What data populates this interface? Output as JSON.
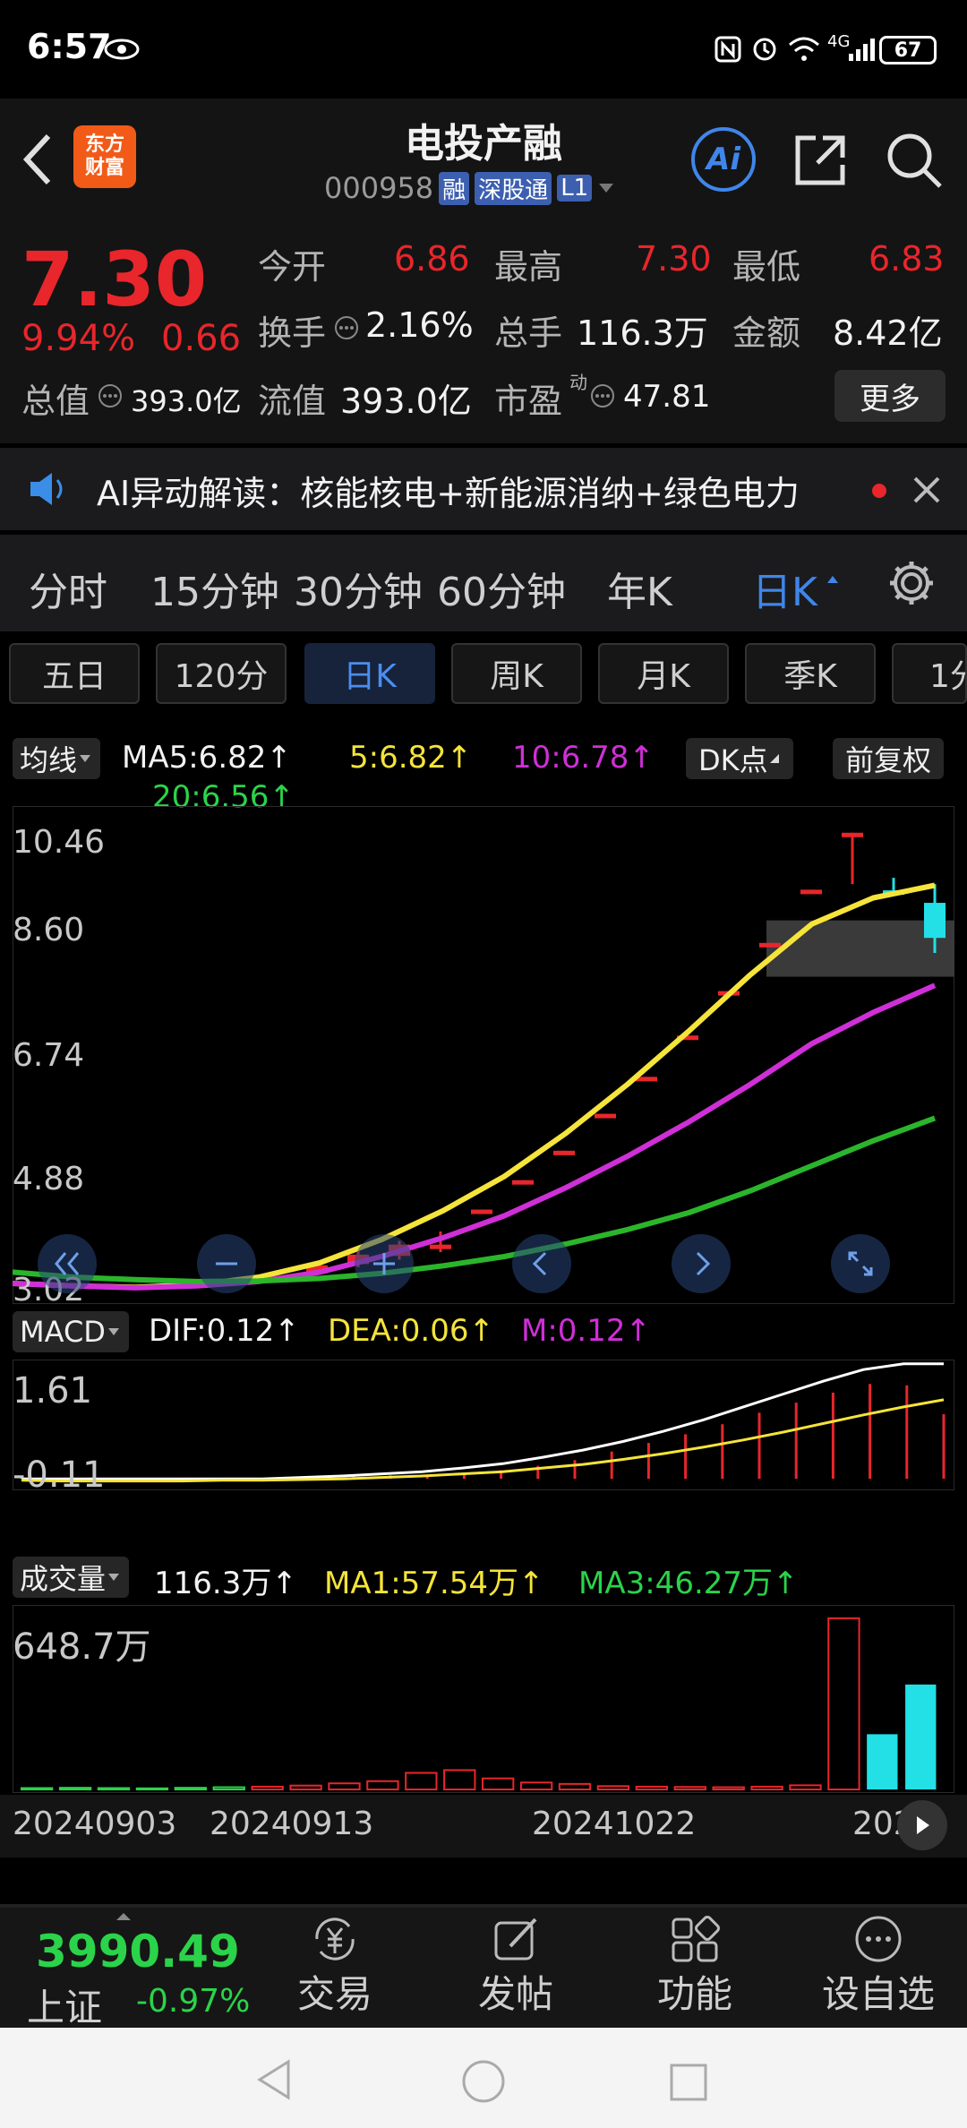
{
  "status_bar": {
    "time": "6:57",
    "network": "4G",
    "battery": "67"
  },
  "header": {
    "logo_line1": "东方",
    "logo_line2": "财富",
    "stock_name": "电投产融",
    "stock_code": "000958",
    "badges": [
      "融",
      "深股通",
      "L1"
    ],
    "ai_label": "Ai"
  },
  "quote": {
    "price": "7.30",
    "change_pct": "9.94%",
    "change_amt": "0.66",
    "open_label": "今开",
    "open": "6.86",
    "high_label": "最高",
    "high": "7.30",
    "low_label": "最低",
    "low": "6.83",
    "turnover_label": "换手",
    "turnover": "2.16%",
    "volume_label": "总手",
    "volume": "116.3万",
    "amount_label": "金额",
    "amount": "8.42亿",
    "total_value_label": "总值",
    "total_value": "393.0亿",
    "float_value_label": "流值",
    "float_value": "393.0亿",
    "pe_label": "市盈",
    "pe_sup": "动",
    "pe": "47.81",
    "more_button": "更多"
  },
  "ai_banner": {
    "text": "AI异动解读：核能核电+新能源消纳+绿色电力"
  },
  "period_tabs": {
    "items": [
      "分时",
      "15分钟",
      "30分钟",
      "60分钟",
      "年K",
      "日K"
    ],
    "active": "日K"
  },
  "sub_tabs": {
    "items": [
      "五日",
      "120分",
      "日K",
      "周K",
      "月K",
      "季K",
      "1分"
    ],
    "active": "日K"
  },
  "indicators": {
    "ma_select": "均线",
    "ma5": "MA5:6.82↑",
    "ma5b": "5:6.82↑",
    "ma10": "10:6.78↑",
    "ma20": "20:6.56↑",
    "dk_button": "DK点",
    "adjust_button": "前复权",
    "macd_select": "MACD",
    "dif": "DIF:0.12↑",
    "dea": "DEA:0.06↑",
    "m": "M:0.12↑",
    "vol_select": "成交量",
    "vol": "116.3万↑",
    "vol_ma1": "MA1:57.54万↑",
    "vol_ma3": "MA3:46.27万↑"
  },
  "chart_data": [
    {
      "type": "candlestick",
      "title": "",
      "y_ticks": [
        "10.46",
        "8.60",
        "6.74",
        "4.88",
        "3.02"
      ],
      "ylim": [
        3.02,
        10.46
      ],
      "candles": [
        {
          "open": 3.28,
          "close": 3.41,
          "high": 3.45,
          "low": 3.25
        },
        {
          "open": 3.43,
          "close": 3.58,
          "high": 3.65,
          "low": 3.38
        },
        {
          "open": 3.56,
          "close": 3.74,
          "high": 3.8,
          "low": 3.5
        },
        {
          "open": 3.74,
          "close": 3.7,
          "high": 3.95,
          "low": 3.62
        },
        {
          "open": 4.25,
          "close": 4.3,
          "high": 4.3,
          "low": 4.25
        },
        {
          "open": 4.72,
          "close": 4.77,
          "high": 4.77,
          "low": 4.72
        },
        {
          "open": 5.18,
          "close": 5.24,
          "high": 5.24,
          "low": 5.18
        },
        {
          "open": 5.77,
          "close": 5.83,
          "high": 5.83,
          "low": 5.77
        },
        {
          "open": 6.36,
          "close": 6.42,
          "high": 6.42,
          "low": 6.36
        },
        {
          "open": 7.02,
          "close": 7.08,
          "high": 7.08,
          "low": 7.02
        },
        {
          "open": 7.73,
          "close": 7.79,
          "high": 7.79,
          "low": 7.73
        },
        {
          "open": 8.5,
          "close": 8.56,
          "high": 8.56,
          "low": 8.5
        },
        {
          "open": 9.35,
          "close": 9.41,
          "high": 9.41,
          "low": 9.35
        },
        {
          "open": 10.26,
          "close": 10.32,
          "high": 10.32,
          "low": 9.5
        },
        {
          "open": 9.4,
          "close": 9.34,
          "high": 9.6,
          "low": 9.34
        },
        {
          "open": 9.2,
          "close": 8.64,
          "high": 9.5,
          "low": 8.4
        }
      ],
      "series": [
        {
          "name": "MA5",
          "color": "#f5e43a",
          "values": [
            3.12,
            3.08,
            3.06,
            3.1,
            3.22,
            3.45,
            3.82,
            4.28,
            4.83,
            5.52,
            6.3,
            7.15,
            8.05,
            8.86,
            9.28,
            9.48
          ]
        },
        {
          "name": "MA10",
          "color": "#cf2fd7",
          "values": [
            3.12,
            3.08,
            3.05,
            3.08,
            3.15,
            3.3,
            3.55,
            3.85,
            4.2,
            4.65,
            5.15,
            5.7,
            6.3,
            6.95,
            7.45,
            7.88
          ]
        },
        {
          "name": "MA20",
          "color": "#2bb52b",
          "values": [
            3.3,
            3.22,
            3.18,
            3.15,
            3.16,
            3.2,
            3.28,
            3.4,
            3.55,
            3.75,
            3.98,
            4.25,
            4.6,
            5.0,
            5.4,
            5.76
          ]
        }
      ]
    },
    {
      "type": "bar",
      "title": "MACD",
      "y_ticks": [
        "1.61",
        "-0.11"
      ],
      "ylim": [
        -0.11,
        1.61
      ],
      "values": [
        0.0,
        0.0,
        0.0,
        0.0,
        0.0,
        0.0,
        0.01,
        0.02,
        0.03,
        0.04,
        0.05,
        0.06,
        0.08,
        0.12,
        0.18,
        0.26,
        0.38,
        0.5,
        0.62,
        0.76,
        0.92,
        1.06,
        1.2,
        1.32,
        1.3,
        0.9
      ],
      "series": [
        {
          "name": "DIF",
          "color": "#ffffff",
          "values": [
            0.0,
            0.0,
            0.0,
            0.0,
            0.0,
            0.0,
            0.0,
            0.02,
            0.04,
            0.07,
            0.1,
            0.15,
            0.21,
            0.3,
            0.4,
            0.52,
            0.66,
            0.82,
            1.0,
            1.18,
            1.36,
            1.52,
            1.6,
            1.6
          ]
        },
        {
          "name": "DEA",
          "color": "#f5e43a",
          "values": [
            -0.02,
            -0.03,
            -0.03,
            -0.03,
            -0.03,
            -0.02,
            -0.02,
            -0.01,
            0.0,
            0.02,
            0.04,
            0.07,
            0.1,
            0.15,
            0.2,
            0.27,
            0.35,
            0.44,
            0.54,
            0.65,
            0.77,
            0.89,
            1.0,
            1.1
          ]
        }
      ]
    },
    {
      "type": "bar",
      "title": "成交量",
      "y_ticks": [
        "648.7万"
      ],
      "ylim": [
        0,
        648.7
      ],
      "x_ticks": [
        "20240903",
        "20240913",
        "20241022",
        "202"
      ],
      "values": [
        5,
        6,
        5,
        4,
        6,
        8,
        10,
        14,
        22,
        30,
        60,
        70,
        40,
        25,
        20,
        12,
        10,
        9,
        8,
        10,
        15,
        620,
        200,
        380
      ],
      "colors": [
        "#2bd34a",
        "#2bd34a",
        "#2bd34a",
        "#2bd34a",
        "#2bd34a",
        "#2bd34a",
        "#e8262b",
        "#e8262b",
        "#e8262b",
        "#e8262b",
        "#e8262b",
        "#e8262b",
        "#e8262b",
        "#e8262b",
        "#e8262b",
        "#e8262b",
        "#e8262b",
        "#e8262b",
        "#e8262b",
        "#e8262b",
        "#e8262b",
        "#e8262b",
        "#22e0e6",
        "#22e0e6"
      ]
    }
  ],
  "bottom_nav": {
    "index_value": "3990.49",
    "index_name": "上证",
    "index_change": "-0.97%",
    "items": [
      "交易",
      "发帖",
      "功能",
      "设自选"
    ]
  }
}
